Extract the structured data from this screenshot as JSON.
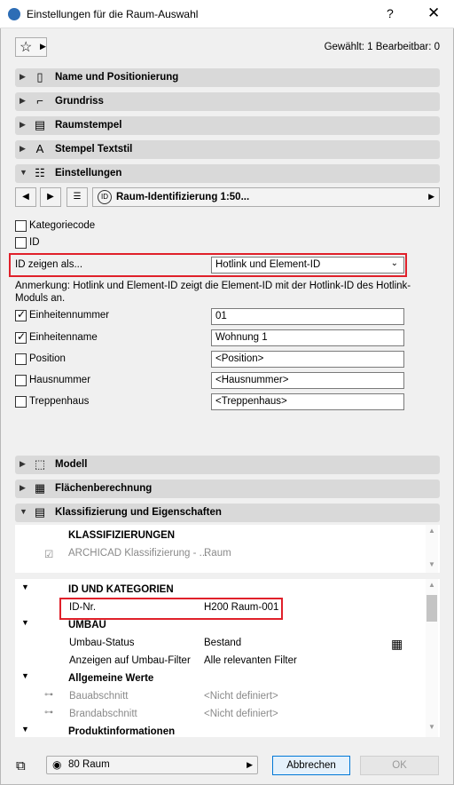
{
  "window": {
    "title": "Einstellungen für die Raum-Auswahl",
    "help_label": "?",
    "close_label": "✕"
  },
  "toolbar": {
    "selection_info": "Gewählt: 1 Bearbeitbar: 0"
  },
  "panels": {
    "name_position": "Name und Positionierung",
    "grundriss": "Grundriss",
    "raumstempel": "Raumstempel",
    "stempel_textstil": "Stempel Textstil",
    "einstellungen": "Einstellungen",
    "modell": "Modell",
    "flaechen": "Flächenberechnung",
    "klassifizierung": "Klassifizierung und Eigenschaften"
  },
  "settings": {
    "stamp_selector": "Raum-Identifizierung 1:50...",
    "kategoriecode_label": "Kategoriecode",
    "kategoriecode_checked": false,
    "id_label": "ID",
    "id_checked": false,
    "id_show_label": "ID zeigen als...",
    "id_show_value": "Hotlink und Element-ID",
    "note": "Anmerkung: Hotlink und Element-ID zeigt die Element-ID mit der Hotlink-ID des Hotlink-Moduls an.",
    "rows": [
      {
        "label": "Einheitennummer",
        "checked": true,
        "value": "01"
      },
      {
        "label": "Einheitenname",
        "checked": true,
        "value": "Wohnung 1"
      },
      {
        "label": "Position",
        "checked": false,
        "value": "<Position>"
      },
      {
        "label": "Hausnummer",
        "checked": false,
        "value": "<Hausnummer>"
      },
      {
        "label": "Treppenhaus",
        "checked": false,
        "value": "<Treppenhaus>"
      }
    ]
  },
  "classification": {
    "header": "KLASSIFIZIERUNGEN",
    "system": "ARCHICAD Klassifizierung - ...",
    "value": "Raum"
  },
  "properties": {
    "id_group": "ID UND KATEGORIEN",
    "id_label": "ID-Nr.",
    "id_value": "H200 Raum-001",
    "umbau_group": "UMBAU",
    "umbau_status_label": "Umbau-Status",
    "umbau_status_value": "Bestand",
    "umbau_filter_label": "Anzeigen auf Umbau-Filter",
    "umbau_filter_value": "Alle relevanten Filter",
    "general_group": "Allgemeine Werte",
    "bauabschnitt_label": "Bauabschnitt",
    "bauabschnitt_value": "<Nicht definiert>",
    "brandabschnitt_label": "Brandabschnitt",
    "brandabschnitt_value": "<Nicht definiert>",
    "product_group": "Produktinformationen"
  },
  "footer": {
    "layer": "80 Raum",
    "cancel_label": "Abbrechen",
    "ok_label": "OK"
  },
  "colors": {
    "highlight": "#e0202a",
    "panel_bg": "#d9d9d9"
  }
}
